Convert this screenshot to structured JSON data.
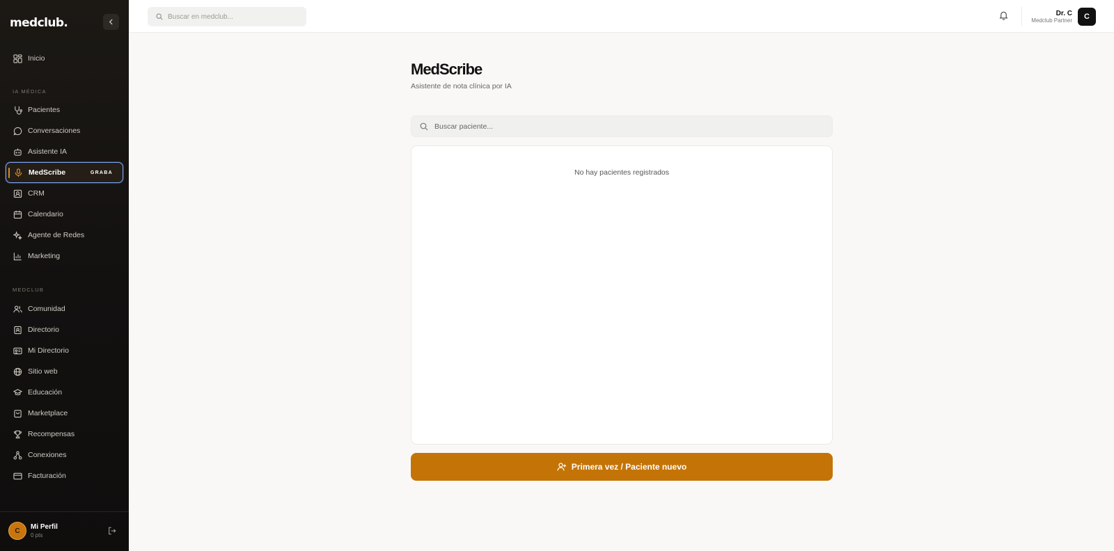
{
  "sidebar": {
    "logo": "medclub.",
    "nav_top": [
      {
        "label": "Inicio",
        "icon": "grid-icon"
      }
    ],
    "section_ia": "IA MÉDICA",
    "nav_ia": [
      {
        "label": "Pacientes",
        "icon": "stethoscope-icon"
      },
      {
        "label": "Conversaciones",
        "icon": "chat-icon"
      },
      {
        "label": "Asistente IA",
        "icon": "robot-icon"
      },
      {
        "label": "MedScribe",
        "icon": "microphone-icon",
        "badge": "GRABA",
        "active": true
      },
      {
        "label": "CRM",
        "icon": "contact-icon"
      },
      {
        "label": "Calendario",
        "icon": "calendar-icon"
      },
      {
        "label": "Agente de Redes",
        "icon": "sparkle-icon"
      },
      {
        "label": "Marketing",
        "icon": "bar-chart-icon"
      }
    ],
    "section_medclub": "MEDCLUB",
    "nav_medclub": [
      {
        "label": "Comunidad",
        "icon": "users-icon"
      },
      {
        "label": "Directorio",
        "icon": "book-icon"
      },
      {
        "label": "Mi Directorio",
        "icon": "id-card-icon"
      },
      {
        "label": "Sitio web",
        "icon": "globe-icon"
      },
      {
        "label": "Educación",
        "icon": "graduation-cap-icon"
      },
      {
        "label": "Marketplace",
        "icon": "shopping-bag-icon"
      },
      {
        "label": "Recompensas",
        "icon": "trophy-icon"
      },
      {
        "label": "Conexiones",
        "icon": "network-icon"
      },
      {
        "label": "Facturación",
        "icon": "credit-card-icon"
      }
    ],
    "profile": {
      "initial": "C",
      "name": "Mi Perfil",
      "points": "0 pts"
    }
  },
  "topbar": {
    "search_placeholder": "Buscar en medclub...",
    "user_name": "Dr. C",
    "user_role": "Medclub Partner",
    "user_initial": "C"
  },
  "main": {
    "title": "MedScribe",
    "subtitle": "Asistente de nota clínica por IA",
    "search_placeholder": "Buscar paciente...",
    "empty_message": "No hay pacientes registrados",
    "new_patient_label": "Primera vez / Paciente nuevo"
  },
  "colors": {
    "accent": "#c47406",
    "active_border": "#7aa3ee",
    "sidebar_bg": "#131110"
  }
}
